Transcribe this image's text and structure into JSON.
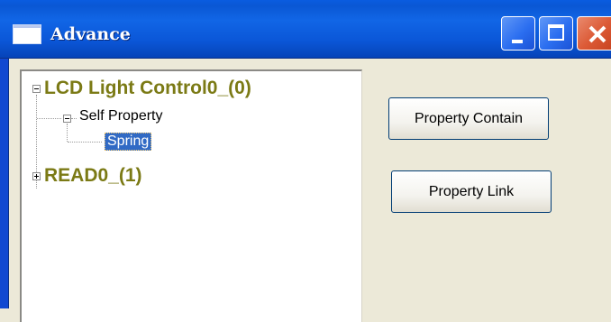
{
  "window": {
    "title": "Advance",
    "controls": [
      "minimize",
      "maximize",
      "close"
    ],
    "colors": {
      "titlebar": "#0a5ce0",
      "close": "#dc5a36",
      "face": "#ece9d8",
      "selection": "#316ac5",
      "root_text": "#7b7a15"
    }
  },
  "tree": {
    "nodes": [
      {
        "label": "LCD Light Control0_(0)",
        "expanded": true,
        "children": [
          {
            "label": "Self Property",
            "expanded": true,
            "children": [
              {
                "label": "Spring",
                "selected": true
              }
            ]
          }
        ]
      },
      {
        "label": "READ0_(1)",
        "expanded": false
      }
    ]
  },
  "buttons": {
    "property_contain": "Property Contain",
    "property_link": "Property Link"
  }
}
